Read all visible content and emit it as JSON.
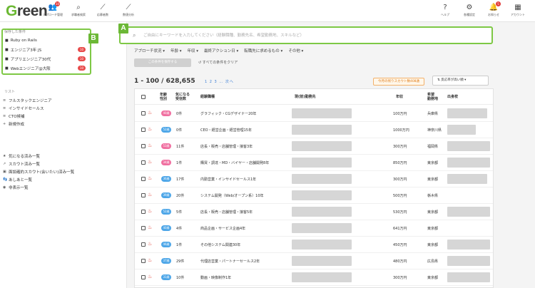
{
  "header": {
    "logo": "Green",
    "nav": [
      {
        "label": "アプローチ管理",
        "icon": "user-group-icon",
        "glyph": "👥",
        "badge": "10"
      },
      {
        "label": "求職者検索",
        "icon": "search-icon",
        "glyph": "⌕",
        "badge": ""
      },
      {
        "label": "応募者数",
        "icon": "chart-icon",
        "glyph": "⟋",
        "badge": ""
      },
      {
        "label": "数値分析",
        "icon": "trend-icon",
        "glyph": "⟋",
        "badge": ""
      }
    ],
    "right_nav": [
      {
        "label": "ヘルプ",
        "icon": "help-icon",
        "glyph": "?",
        "badge": ""
      },
      {
        "label": "各種設定",
        "icon": "gear-icon",
        "glyph": "⚙",
        "badge": ""
      },
      {
        "label": "お知らせ",
        "icon": "bell-icon",
        "glyph": "🔔",
        "badge": "5"
      },
      {
        "label": "アカウント",
        "icon": "building-icon",
        "glyph": "▦",
        "badge": ""
      }
    ]
  },
  "callouts": {
    "a": "A",
    "b": "B"
  },
  "sidebar": {
    "saved_title": "保存した条件",
    "saved": [
      {
        "label": "Ruby on Rails",
        "count": ""
      },
      {
        "label": "エンジニア3年 JS",
        "count": "10"
      },
      {
        "label": "アプリエンジニア30代",
        "count": "10"
      },
      {
        "label": "Webエンジニア@大阪",
        "count": "10"
      }
    ],
    "list_title": "リスト",
    "lists": [
      {
        "label": "フルスタックエンジニア",
        "glyph": "≡"
      },
      {
        "label": "インサイドセールス",
        "glyph": "≡"
      },
      {
        "label": "CTO候補",
        "glyph": "≡"
      },
      {
        "label": "新規作成",
        "glyph": "+"
      }
    ],
    "links": [
      {
        "label": "気になる済み一覧",
        "glyph": "★"
      },
      {
        "label": "スカウト済み一覧",
        "glyph": "↗"
      },
      {
        "label": "面談確約スカウト(会いたい)済み一覧",
        "glyph": "▣"
      },
      {
        "label": "あしあと一覧",
        "glyph": "👣"
      },
      {
        "label": "非表示一覧",
        "glyph": "◉"
      }
    ]
  },
  "search": {
    "placeholder": "ご自由にキーワードを入力してください（経験職種、勤務先名、希望勤務地、スキルなど）"
  },
  "filters": [
    "アプローチ状況 ▾",
    "年齢 ▾",
    "年収 ▾",
    "最終アクション日 ▾",
    "転職先に求めるもの ▾",
    "その他 ▾"
  ],
  "save_condition": "この条件を保存する",
  "clear_conditions": "すべての条件をクリア",
  "results": {
    "count": "1 - 100 / 628,655",
    "pager": "1 2 3 … 次へ"
  },
  "promo": "今月の残りスカウト数408通",
  "sort": "反応率が高い順 ▾",
  "table": {
    "headers": {
      "age": "年齢",
      "gender": "性別",
      "interest": "気になる",
      "interest2": "受信数",
      "job": "経験職種",
      "company": "現(前)勤務先",
      "salary": "年収",
      "location": "希望",
      "location2": "勤務地",
      "school": "出身校"
    },
    "rows": [
      {
        "age": "40歳",
        "age_color": "#f06fa0",
        "interest": "0件",
        "job": "グラフィック・CGデザイナー20年",
        "salary": "100万円",
        "location": "兵庫県"
      },
      {
        "age": "52歳",
        "age_color": "#4da6e8",
        "interest": "0件",
        "job": "CEO・経営企画・経営管理15年",
        "salary": "1000万円",
        "location": "神奈川県"
      },
      {
        "age": "53歳",
        "age_color": "#f06fa0",
        "interest": "11件",
        "job": "店長・販売・店舗管理・接客3年",
        "salary": "300万円",
        "location": "福岡県"
      },
      {
        "age": "34歳",
        "age_color": "#f06fa0",
        "interest": "1件",
        "job": "購買・調達・MD・バイヤー・店舗開発8年",
        "salary": "850万円",
        "location": "東京都"
      },
      {
        "age": "36歳",
        "age_color": "#4da6e8",
        "interest": "17件",
        "job": "内勤営業・インサイドセールス1年",
        "salary": "300万円",
        "location": "東京都"
      },
      {
        "age": "39歳",
        "age_color": "#4da6e8",
        "interest": "20件",
        "job": "システム開発（Web/オープン系）10年",
        "salary": "500万円",
        "location": "栃木県"
      },
      {
        "age": "52歳",
        "age_color": "#4da6e8",
        "interest": "5件",
        "job": "店長・販売・店舗管理・接客5年",
        "salary": "530万円",
        "location": "東京都"
      },
      {
        "age": "40歳",
        "age_color": "#4da6e8",
        "interest": "4件",
        "job": "商品企画・サービス企画4年",
        "salary": "641万円",
        "location": "東京都"
      },
      {
        "age": "46歳",
        "age_color": "#4da6e8",
        "interest": "1件",
        "job": "その他システム関連30年",
        "salary": "450万円",
        "location": "東京都"
      },
      {
        "age": "37歳",
        "age_color": "#4da6e8",
        "interest": "29件",
        "job": "代理店営業・パートナーセールス2年",
        "salary": "480万円",
        "location": "広島県"
      },
      {
        "age": "31歳",
        "age_color": "#4da6e8",
        "interest": "10件",
        "job": "動画・映像制作1年",
        "salary": "300万円",
        "location": "東京都"
      }
    ]
  }
}
